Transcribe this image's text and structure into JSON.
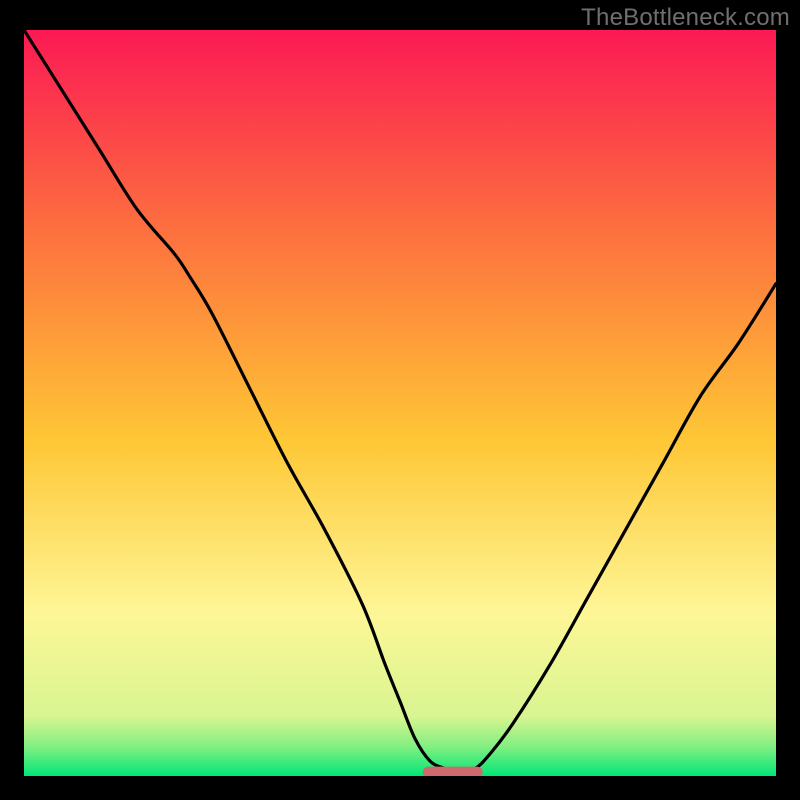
{
  "attribution": "TheBottleneck.com",
  "colors": {
    "frame": "#000000",
    "top": "#fb1954",
    "mid": "#fec735",
    "lower": "#fef696",
    "green": "#02e676",
    "curve": "#000000",
    "marker": "#ce6a6f"
  },
  "chart_data": {
    "type": "line",
    "title": "",
    "xlabel": "",
    "ylabel": "",
    "xlim": [
      0,
      100
    ],
    "ylim": [
      0,
      100
    ],
    "grid": false,
    "series": [
      {
        "name": "bottleneck-curve",
        "x": [
          0,
          5,
          10,
          15,
          20,
          22,
          25,
          30,
          35,
          40,
          45,
          48,
          50,
          52,
          54,
          56,
          58,
          60,
          62,
          65,
          70,
          75,
          80,
          85,
          90,
          95,
          100
        ],
        "y": [
          100,
          92,
          84,
          76,
          70,
          67,
          62,
          52,
          42,
          33,
          23,
          15,
          10,
          5,
          2,
          1,
          0.5,
          1,
          3,
          7,
          15,
          24,
          33,
          42,
          51,
          58,
          66
        ]
      }
    ],
    "marker": {
      "x": 57,
      "y": 0.5,
      "width": 8,
      "height": 1.5
    },
    "gradient_stops": [
      {
        "pct": 0,
        "color": "#fb1954"
      },
      {
        "pct": 26,
        "color": "#fd6d3f"
      },
      {
        "pct": 55,
        "color": "#fec735"
      },
      {
        "pct": 78,
        "color": "#fef696"
      },
      {
        "pct": 92,
        "color": "#d8f591"
      },
      {
        "pct": 96,
        "color": "#84ef82"
      },
      {
        "pct": 100,
        "color": "#02e676"
      }
    ]
  }
}
